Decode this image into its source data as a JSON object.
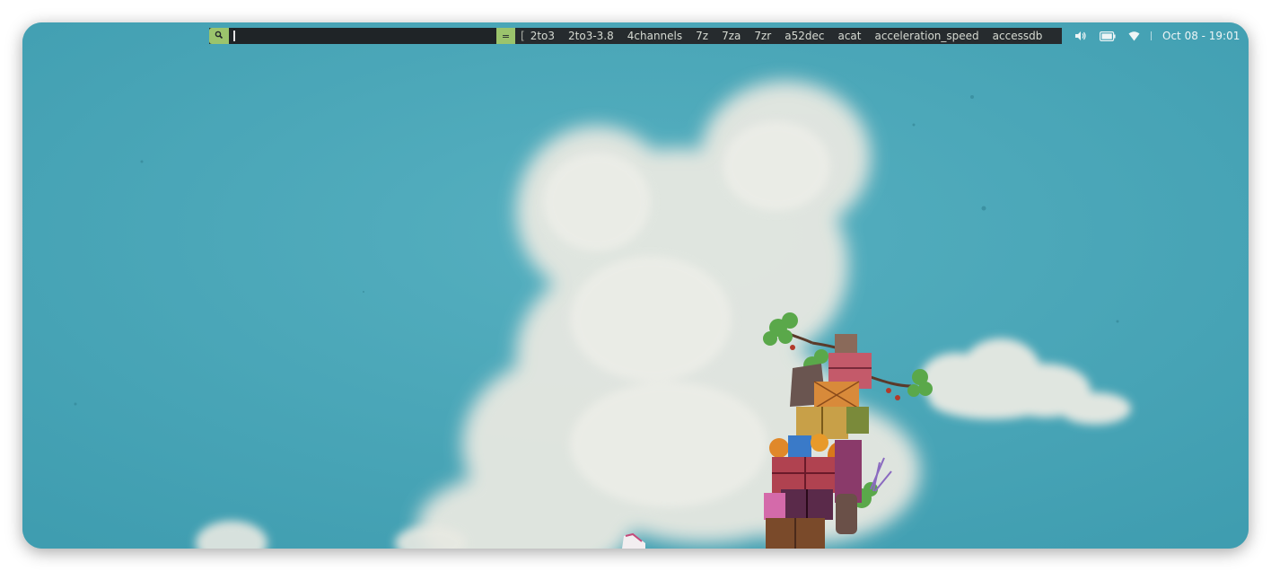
{
  "launcher": {
    "search_icon": "search-icon",
    "input_value": "",
    "eq_label": "=",
    "bracket": "[",
    "suggestions": [
      "2to3",
      "2to3-3.8",
      "4channels",
      "7z",
      "7za",
      "7zr",
      "a52dec",
      "acat",
      "acceleration_speed",
      "accessdb"
    ]
  },
  "tray": {
    "icons": [
      "volume-icon",
      "battery-icon",
      "wifi-icon"
    ],
    "separator": "|",
    "clock": "Oct 08 - 19:01"
  },
  "colors": {
    "sky": "#4aa6b8",
    "bar_bg": "#262b2e",
    "accent_green": "#9bc46c"
  }
}
